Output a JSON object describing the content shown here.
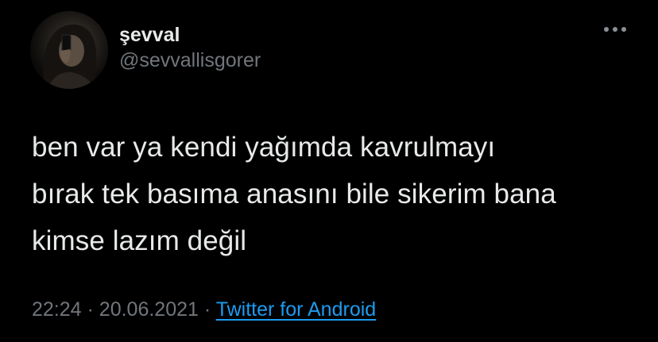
{
  "tweet": {
    "author": {
      "display_name": "şevval",
      "handle": "@sevvallisgorer"
    },
    "text_lines": [
      "ben var ya kendi yağımda kavrulmayı",
      "bırak tek basıma anasını bile sikerim bana",
      "kimse lazım değil"
    ],
    "time": "22:24",
    "separator": "·",
    "date": "20.06.2021",
    "source": "Twitter for Android"
  },
  "icons": {
    "more": "more-horizontal-icon"
  },
  "colors": {
    "background": "#000000",
    "primary_text": "#e7e9ea",
    "secondary_text": "#71767b",
    "link": "#1d9bf0"
  }
}
